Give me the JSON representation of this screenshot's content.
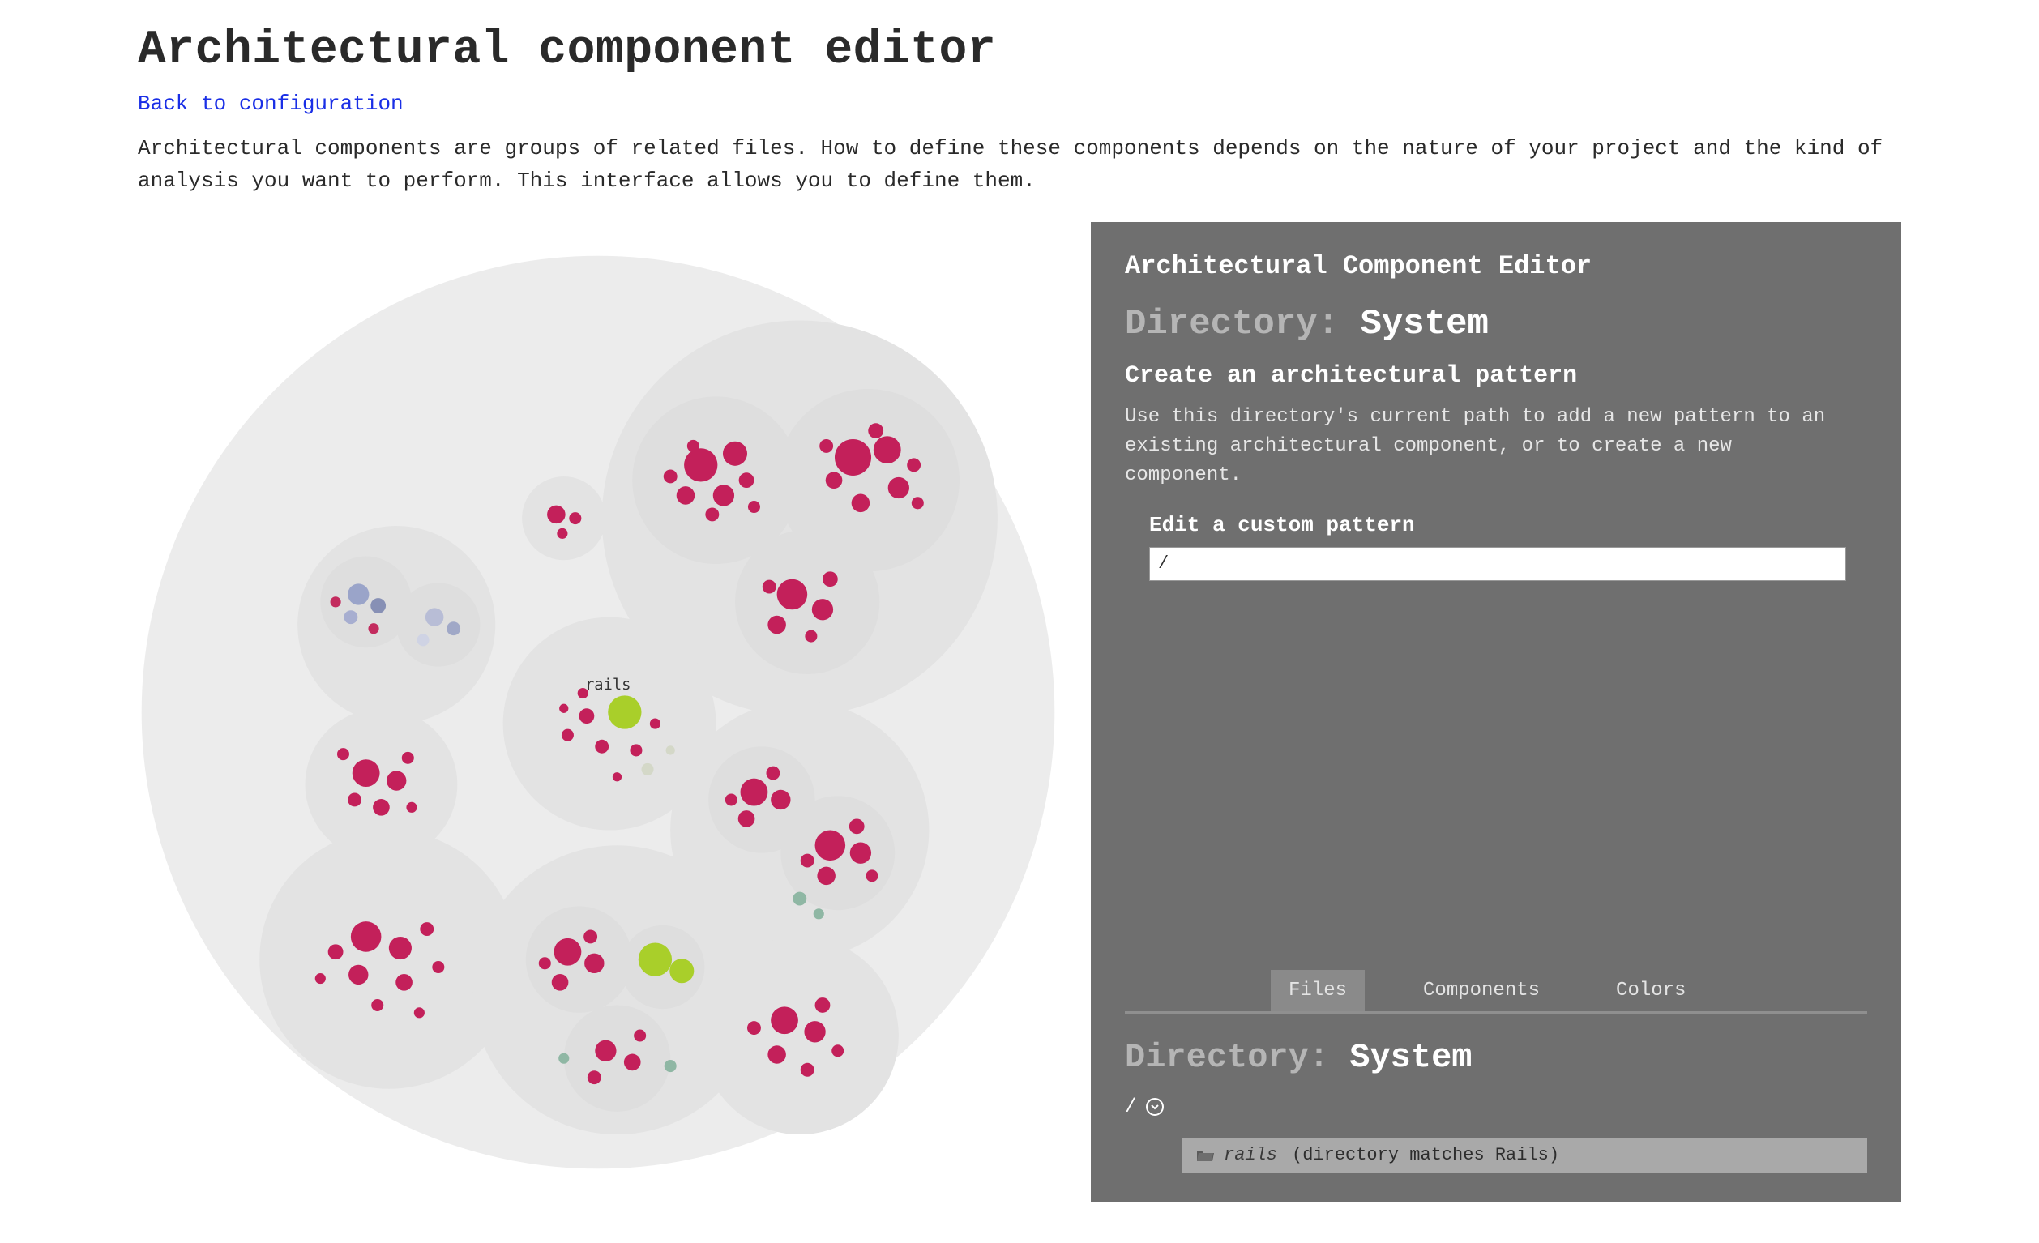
{
  "header": {
    "title": "Architectural component editor",
    "back_link": "Back to configuration",
    "description": "Architectural components are groups of related files. How to define these components depends on the nature of your project and the kind of analysis you want to perform. This interface allows you to define them."
  },
  "vis": {
    "node_label": "rails"
  },
  "panel": {
    "title": "Architectural Component Editor",
    "directory_label": "Directory:",
    "directory_value": "System",
    "create_heading": "Create an architectural pattern",
    "create_desc": "Use this directory's current path to add a new pattern to an existing architectural component, or to create a new component.",
    "field_label": "Edit a custom pattern",
    "pattern_value": "/",
    "tabs": [
      "Files",
      "Components",
      "Colors"
    ],
    "active_tab": "Files",
    "files": {
      "directory_label": "Directory:",
      "directory_value": "System",
      "path": "/",
      "entry_name": "rails",
      "entry_note": "(directory matches Rails)"
    }
  }
}
